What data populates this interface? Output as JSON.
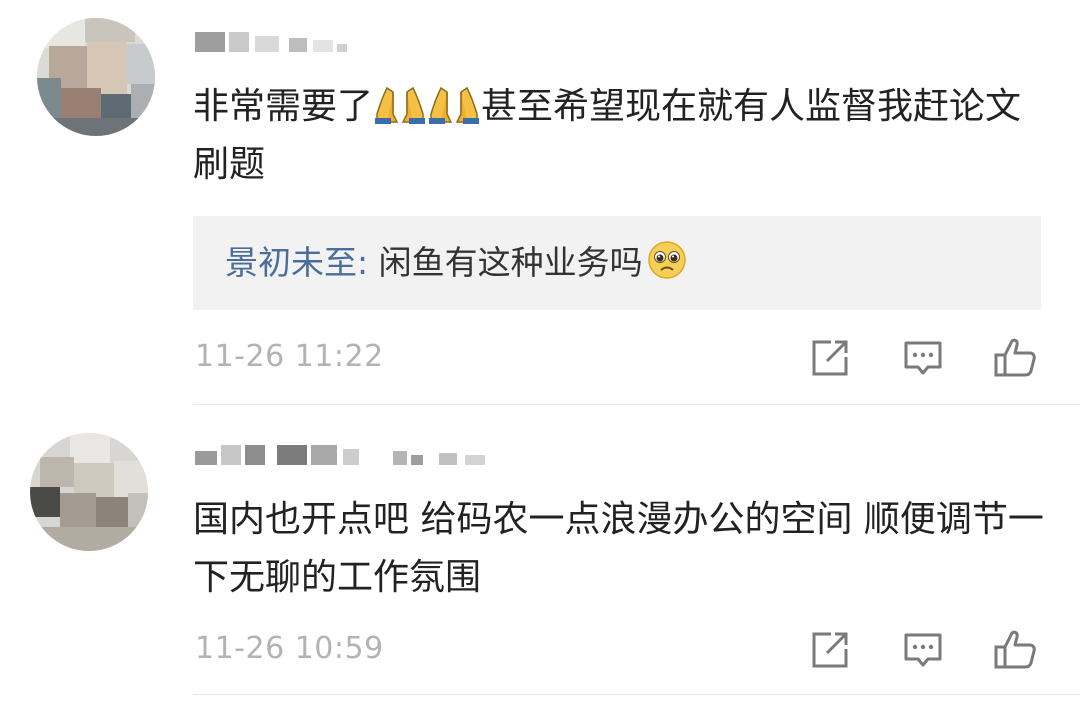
{
  "comments": [
    {
      "username": "",
      "text_before": "非常需要了",
      "text_after": "甚至希望现在就有人监督我赶论文刷题",
      "reply": {
        "name": "景初未至",
        "separator": ": ",
        "text": "闲鱼有这种业务吗"
      },
      "timestamp": "11-26 11:22",
      "icons": {
        "emoji": "folded-hands-emoji",
        "reply_emoji": "pleading-face-emoji",
        "share": "share-edit-icon",
        "comment": "comment-icon",
        "like": "thumbs-up-icon"
      }
    },
    {
      "username": "",
      "text": "国内也开点吧  给码农一点浪漫办公的空间 顺便调节一下无聊的工作氛围",
      "timestamp": "11-26 10:59",
      "icons": {
        "share": "share-edit-icon",
        "comment": "comment-icon",
        "like": "thumbs-up-icon"
      }
    }
  ],
  "colors": {
    "reply_name": "#4a6d9a",
    "timestamp": "#b3b3b3",
    "icon": "#7a7a7a",
    "reply_bg": "#f2f2f2"
  }
}
